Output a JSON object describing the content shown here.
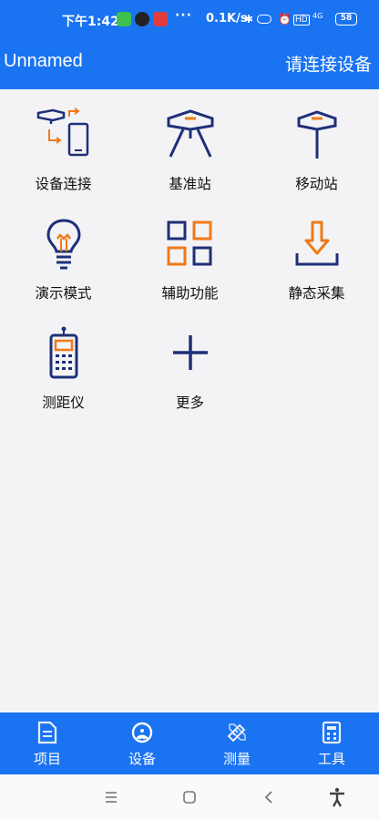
{
  "status": {
    "time": "下午1:42",
    "dots": "···",
    "speed": "0.1K/s",
    "hd": "HD",
    "net": "4G",
    "battery": "58"
  },
  "appbar": {
    "title": "Unnamed",
    "action": "请连接设备"
  },
  "grid": {
    "items": [
      {
        "label": "设备连接",
        "icon": "device-connect-icon"
      },
      {
        "label": "基准站",
        "icon": "base-station-icon"
      },
      {
        "label": "移动站",
        "icon": "rover-station-icon"
      },
      {
        "label": "演示模式",
        "icon": "lightbulb-icon"
      },
      {
        "label": "辅助功能",
        "icon": "grid-squares-icon"
      },
      {
        "label": "静态采集",
        "icon": "download-icon"
      },
      {
        "label": "测距仪",
        "icon": "rangefinder-icon"
      },
      {
        "label": "更多",
        "icon": "plus-icon"
      }
    ]
  },
  "tabs": [
    {
      "label": "项目",
      "icon": "document-icon"
    },
    {
      "label": "设备",
      "icon": "antenna-icon",
      "active": true
    },
    {
      "label": "测量",
      "icon": "ruler-pencil-icon"
    },
    {
      "label": "工具",
      "icon": "calculator-icon"
    }
  ],
  "colors": {
    "primary": "#1a73f0",
    "icon_blue": "#1f2f78",
    "icon_orange": "#f07a1a",
    "background": "#f3f3f5"
  }
}
